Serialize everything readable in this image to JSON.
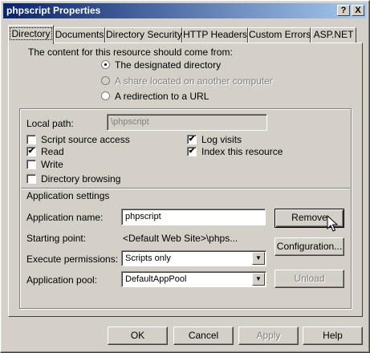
{
  "window": {
    "title": "phpscript Properties",
    "help_btn": "?",
    "close_btn": "X"
  },
  "tabs": [
    "Directory",
    "Documents",
    "Directory Security",
    "HTTP Headers",
    "Custom Errors",
    "ASP.NET"
  ],
  "content_source": {
    "heading": "The content for this resource should come from:",
    "options": [
      "The designated directory",
      "A share located on another computer",
      "A redirection to a URL"
    ],
    "selected": "The designated directory"
  },
  "local_path": {
    "label": "Local path:",
    "value": "\\phpscript"
  },
  "checkboxes": {
    "script_source_access": {
      "label": "Script source access",
      "checked": false
    },
    "read": {
      "label": "Read",
      "checked": true
    },
    "write": {
      "label": "Write",
      "checked": false
    },
    "directory_browsing": {
      "label": "Directory browsing",
      "checked": false
    },
    "log_visits": {
      "label": "Log visits",
      "checked": true
    },
    "index_resource": {
      "label": "Index this resource",
      "checked": true
    }
  },
  "app_settings": {
    "heading": "Application settings",
    "app_name_label": "Application name:",
    "app_name_value": "phpscript",
    "starting_point_label": "Starting point:",
    "starting_point_value": "<Default Web Site>\\phps...",
    "exec_perm_label": "Execute permissions:",
    "exec_perm_value": "Scripts only",
    "app_pool_label": "Application pool:",
    "app_pool_value": "DefaultAppPool",
    "remove_btn": "Remove",
    "config_btn": "Configuration...",
    "unload_btn": "Unload"
  },
  "footer": {
    "ok": "OK",
    "cancel": "Cancel",
    "apply": "Apply",
    "help": "Help"
  },
  "check_glyph": "✔",
  "arrow_glyph": "▼"
}
